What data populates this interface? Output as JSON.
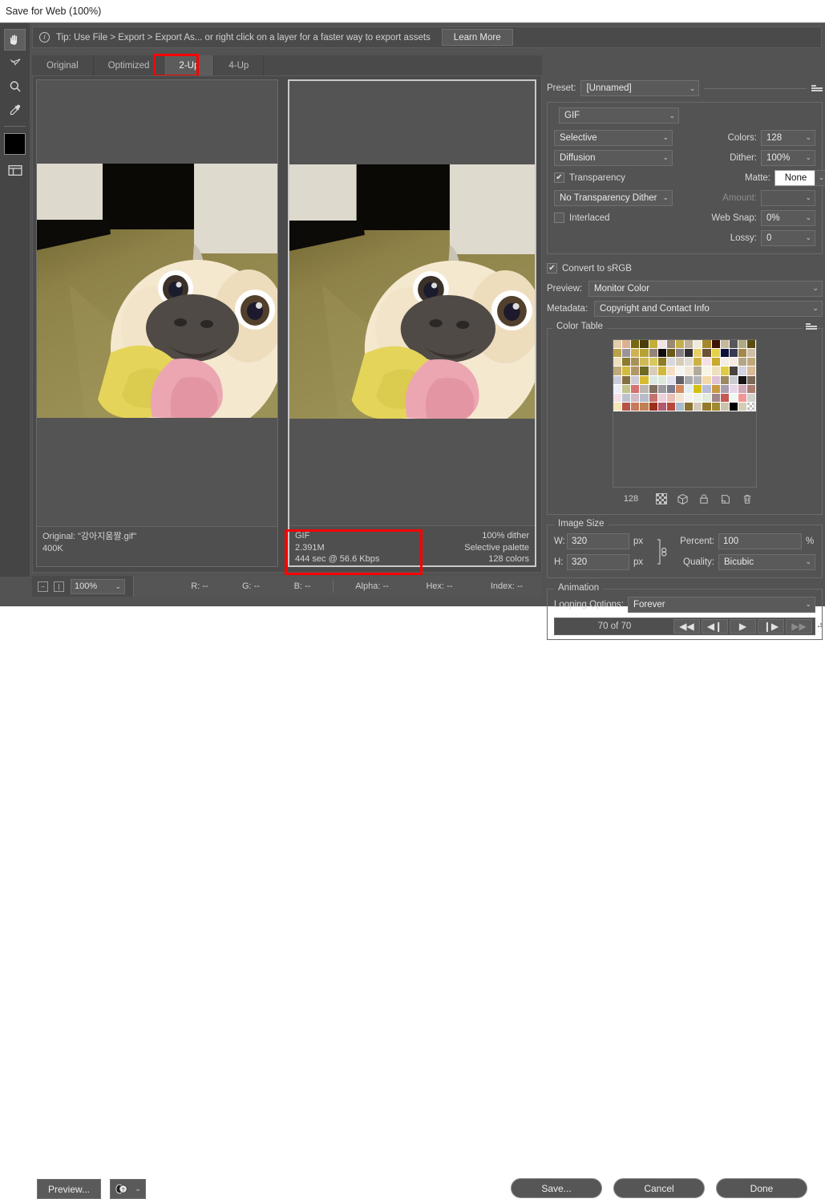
{
  "window": {
    "title": "Save for Web (100%)"
  },
  "tip": {
    "icon": "info-icon",
    "text": "Tip: Use File > Export > Export As...  or right click on a layer for a faster way to export assets",
    "learn_more": "Learn More"
  },
  "tools": [
    {
      "name": "hand-tool",
      "icon": "hand-icon",
      "selected": true
    },
    {
      "name": "slice-select-tool",
      "icon": "slice-select-icon",
      "selected": false
    },
    {
      "name": "zoom-tool",
      "icon": "magnifier-icon",
      "selected": false
    },
    {
      "name": "eyedropper-tool",
      "icon": "eyedropper-icon",
      "selected": false
    }
  ],
  "foreground_color": "#000000",
  "toggle_slices": {
    "name": "toggle-slices-visibility",
    "icon": "slices-icon"
  },
  "tabs": [
    {
      "label": "Original",
      "active": false
    },
    {
      "label": "Optimized",
      "active": false
    },
    {
      "label": "2-Up",
      "active": true
    },
    {
      "label": "4-Up",
      "active": false
    }
  ],
  "highlight_color": "#ff0000",
  "panes": {
    "original": {
      "info": [
        {
          "left": "Original: \"강아지움짤.gif\"",
          "right": ""
        },
        {
          "left": "400K",
          "right": ""
        }
      ]
    },
    "optimized": {
      "info": [
        {
          "left": "GIF",
          "right": "100% dither"
        },
        {
          "left": "2.391M",
          "right": "Selective palette"
        },
        {
          "left": "444 sec @ 56.6 Kbps",
          "right": "128 colors"
        }
      ]
    }
  },
  "statusbar": {
    "zoom": "100%",
    "readouts": [
      {
        "label": "R:",
        "value": "--"
      },
      {
        "label": "G:",
        "value": "--"
      },
      {
        "label": "B:",
        "value": "--"
      }
    ],
    "readouts2": [
      {
        "label": "Alpha:",
        "value": "--"
      },
      {
        "label": "Hex:",
        "value": "--"
      },
      {
        "label": "Index:",
        "value": "--"
      }
    ]
  },
  "settings": {
    "preset_label": "Preset:",
    "preset_value": "[Unnamed]",
    "format": "GIF",
    "reduction_algorithm": "Selective",
    "dither_algorithm": "Diffusion",
    "transparency_label": "Transparency",
    "transparency_checked": true,
    "transparency_dither": "No Transparency Dither",
    "interlaced_label": "Interlaced",
    "interlaced_checked": false,
    "colors_label": "Colors:",
    "colors_value": "128",
    "dither_label": "Dither:",
    "dither_value": "100%",
    "matte_label": "Matte:",
    "matte_value": "None",
    "amount_label": "Amount:",
    "amount_value": "",
    "websnap_label": "Web Snap:",
    "websnap_value": "0%",
    "lossy_label": "Lossy:",
    "lossy_value": "0",
    "convert_srgb_label": "Convert to sRGB",
    "convert_srgb_checked": true,
    "preview_label": "Preview:",
    "preview_value": "Monitor Color",
    "metadata_label": "Metadata:",
    "metadata_value": "Copyright and Contact Info"
  },
  "color_table": {
    "title": "Color Table",
    "count": "128",
    "buttons": [
      {
        "name": "map-to-transparent-button",
        "icon": "checkerboard-icon"
      },
      {
        "name": "shift-to-web-safe-button",
        "icon": "cube-icon"
      },
      {
        "name": "lock-color-button",
        "icon": "lock-icon"
      },
      {
        "name": "new-color-button",
        "icon": "new-swatch-icon"
      },
      {
        "name": "delete-color-button",
        "icon": "trash-icon"
      }
    ],
    "swatches": [
      "#e3ceab",
      "#dcb192",
      "#756610",
      "#4a3d07",
      "#c4ae37",
      "#f0e4e4",
      "#9b8873",
      "#c4b049",
      "#c0ae96",
      "#efeade",
      "#a4882b",
      "#3d1405",
      "#c4b99b",
      "#59565b",
      "#aeab84",
      "#5c4b11",
      "#b9a346",
      "#9a949a",
      "#cfb353",
      "#b7a234",
      "#928379",
      "#120d0c",
      "#6b5a16",
      "#847e82",
      "#332e33",
      "#e6cf69",
      "#6b5337",
      "#e4d14b",
      "#0c0f38",
      "#383a54",
      "#a4874a",
      "#cdbfa8",
      "#eddfc0",
      "#8d7b2e",
      "#a89059",
      "#cfb956",
      "#d7c860",
      "#8e7b23",
      "#d6d8db",
      "#d5ccb9",
      "#e0dcd4",
      "#cdb243",
      "#f4e0e4",
      "#c6a92e",
      "#f3efe5",
      "#f7eae2",
      "#b3a687",
      "#c1a87c",
      "#bfa87a",
      "#d2bc3d",
      "#b39666",
      "#6d6a24",
      "#d7cbbb",
      "#d1b83d",
      "#f6ddc3",
      "#f4f4f0",
      "#f3e7d6",
      "#b2ab9b",
      "#f6f4e4",
      "#ede0bd",
      "#e1cb44",
      "#4a4141",
      "#d3d2e0",
      "#d9b996",
      "#ccccd8",
      "#846f42",
      "#cdcbd4",
      "#d8bb33",
      "#dbe9e2",
      "#dce9db",
      "#e2e2ee",
      "#625f68",
      "#aaa9ac",
      "#b4b3b6",
      "#f2d9a5",
      "#ddc2d5",
      "#9c8962",
      "#c8ccd0",
      "#181315",
      "#7b6757",
      "#eeeef8",
      "#c3c38a",
      "#d5716f",
      "#bdb5b0",
      "#816e5e",
      "#9b999d",
      "#7d7a8c",
      "#d4895f",
      "#e3efef",
      "#d5bf13",
      "#b8bcd8",
      "#c89a40",
      "#a89cae",
      "#e8d6e8",
      "#cfa7b6",
      "#ab7e71",
      "#f5dfe7",
      "#bcc2ce",
      "#cfbcc7",
      "#b8bcc9",
      "#c4736f",
      "#edd0da",
      "#eabfb5",
      "#f4e5d3",
      "#f5f3ee",
      "#eef2e6",
      "#e3ebdf",
      "#a2868c",
      "#c35952",
      "#eff7f3",
      "#f09795",
      "#cfd2cb",
      "#f5e7b8",
      "#b75245",
      "#c57a59",
      "#c08156",
      "#9b2f1d",
      "#b1596f",
      "#b6473a",
      "#a8bccb",
      "#8a7230",
      "#d4c9b9",
      "#94792a",
      "#a08a30",
      "#cbc2ab",
      "#000000",
      "#d3cdb6",
      "#checker"
    ]
  },
  "image_size": {
    "title": "Image Size",
    "w_label": "W:",
    "w_value": "320",
    "w_unit": "px",
    "h_label": "H:",
    "h_value": "320",
    "h_unit": "px",
    "percent_label": "Percent:",
    "percent_value": "100",
    "percent_unit": "%",
    "quality_label": "Quality:",
    "quality_value": "Bicubic",
    "chain_icon": "link-icon"
  },
  "animation": {
    "title": "Animation",
    "looping_label": "Looping Options:",
    "looping_value": "Forever",
    "frame_index": "70 of 70",
    "controls": [
      {
        "name": "first-frame-button",
        "glyph": "◀◀",
        "disabled": false
      },
      {
        "name": "previous-frame-button",
        "glyph": "◀❙",
        "disabled": false
      },
      {
        "name": "play-button",
        "glyph": "▶",
        "disabled": false
      },
      {
        "name": "next-frame-button",
        "glyph": "❙▶",
        "disabled": false
      },
      {
        "name": "last-frame-button",
        "glyph": "▶▶",
        "disabled": true
      }
    ]
  },
  "footer": {
    "preview": "Preview...",
    "browser_icon": "browser-preview-icon",
    "save": "Save...",
    "cancel": "Cancel",
    "done": "Done"
  }
}
